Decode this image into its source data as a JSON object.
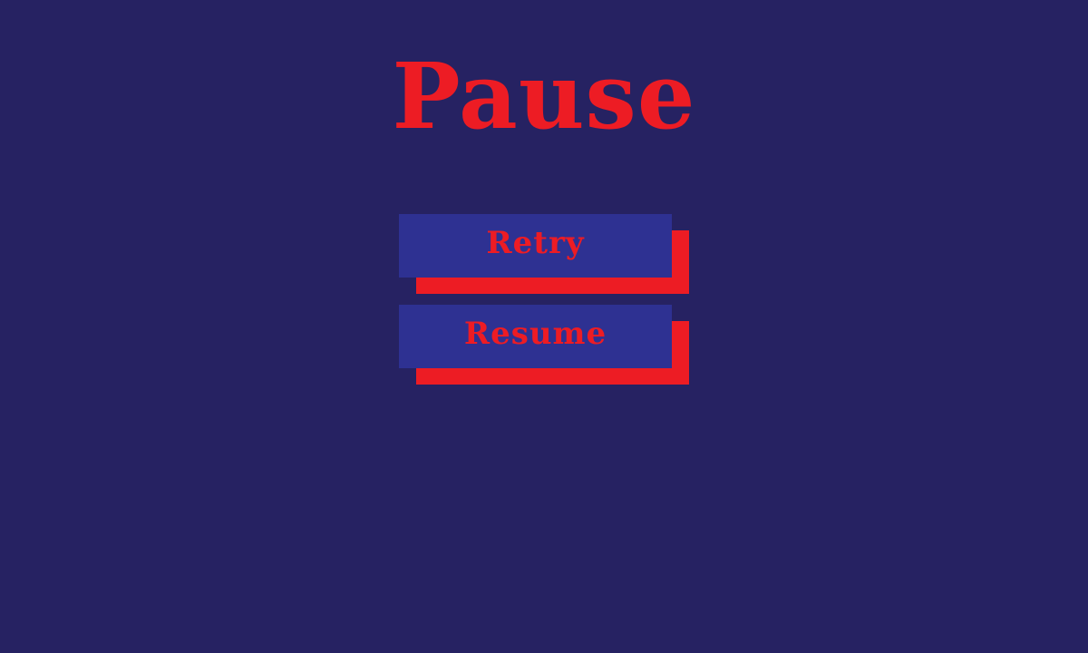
{
  "title": "Pause",
  "menu": {
    "retry_label": "Retry",
    "resume_label": "Resume"
  },
  "colors": {
    "background": "#262262",
    "button_face": "#2E3192",
    "accent_red": "#ED1C24"
  }
}
